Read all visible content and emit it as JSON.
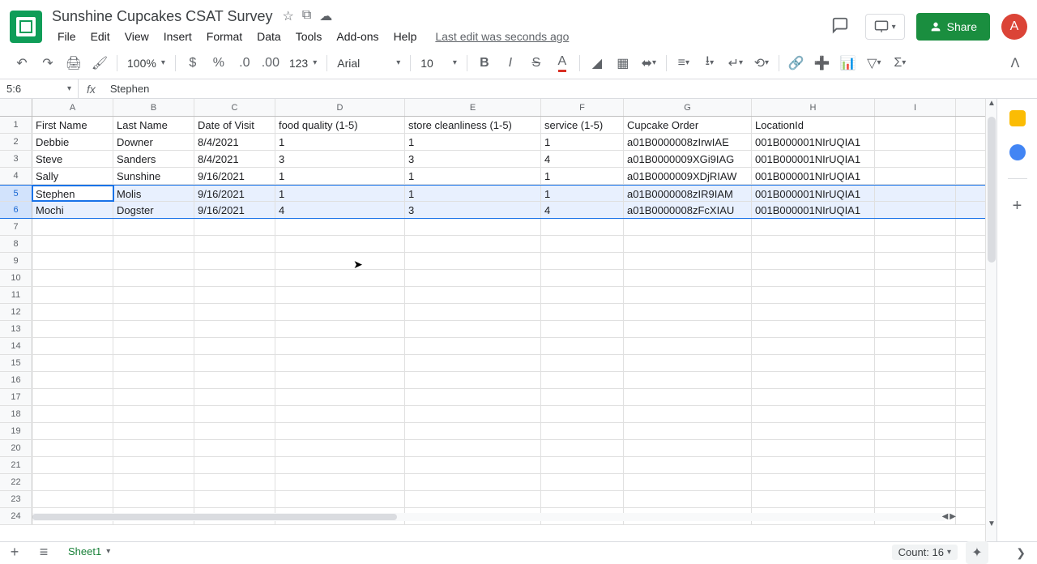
{
  "doc": {
    "title": "Sunshine Cupcakes CSAT Survey"
  },
  "menu": {
    "file": "File",
    "edit": "Edit",
    "view": "View",
    "insert": "Insert",
    "format": "Format",
    "data": "Data",
    "tools": "Tools",
    "addons": "Add-ons",
    "help": "Help",
    "last_edit": "Last edit was seconds ago"
  },
  "header": {
    "share": "Share",
    "avatar": "A"
  },
  "toolbar": {
    "zoom": "100%",
    "fmt123": "123",
    "font": "Arial",
    "size": "10"
  },
  "namebox": {
    "ref": "5:6",
    "formula": "Stephen"
  },
  "columns": [
    "A",
    "B",
    "C",
    "D",
    "E",
    "F",
    "G",
    "H",
    "I",
    ""
  ],
  "col_widths": [
    "cw-A",
    "cw-B",
    "cw-C",
    "cw-D",
    "cw-E",
    "cw-F",
    "cw-G",
    "cw-H",
    "cw-I",
    "cw-J"
  ],
  "headers_row": [
    "First Name",
    "Last Name",
    "Date of Visit",
    "food quality (1-5)",
    "store cleanliness (1-5)",
    "service (1-5)",
    "Cupcake Order",
    "LocationId",
    "",
    ""
  ],
  "data_rows": [
    [
      "Debbie",
      "Downer",
      "8/4/2021",
      "1",
      "1",
      "1",
      "a01B0000008zIrwIAE",
      "001B000001NIrUQIA1",
      "",
      ""
    ],
    [
      "Steve",
      "Sanders",
      "8/4/2021",
      "3",
      "3",
      "4",
      "a01B0000009XGi9IAG",
      "001B000001NIrUQIA1",
      "",
      ""
    ],
    [
      "Sally",
      "Sunshine",
      "9/16/2021",
      "1",
      "1",
      "1",
      "a01B0000009XDjRIAW",
      "001B000001NIrUQIA1",
      "",
      ""
    ],
    [
      "Stephen",
      "Molis",
      "9/16/2021",
      "1",
      "1",
      "1",
      "a01B0000008zIR9IAM",
      "001B000001NIrUQIA1",
      "",
      ""
    ],
    [
      "Mochi",
      "Dogster",
      "9/16/2021",
      "4",
      "3",
      "4",
      "a01B0000008zFcXIAU",
      "001B000001NIrUQIA1",
      "",
      ""
    ]
  ],
  "selected_rows": [
    5,
    6
  ],
  "active_cell": {
    "row": 5,
    "col": 0
  },
  "sheet": {
    "name": "Sheet1"
  },
  "status": {
    "count": "Count: 16"
  }
}
